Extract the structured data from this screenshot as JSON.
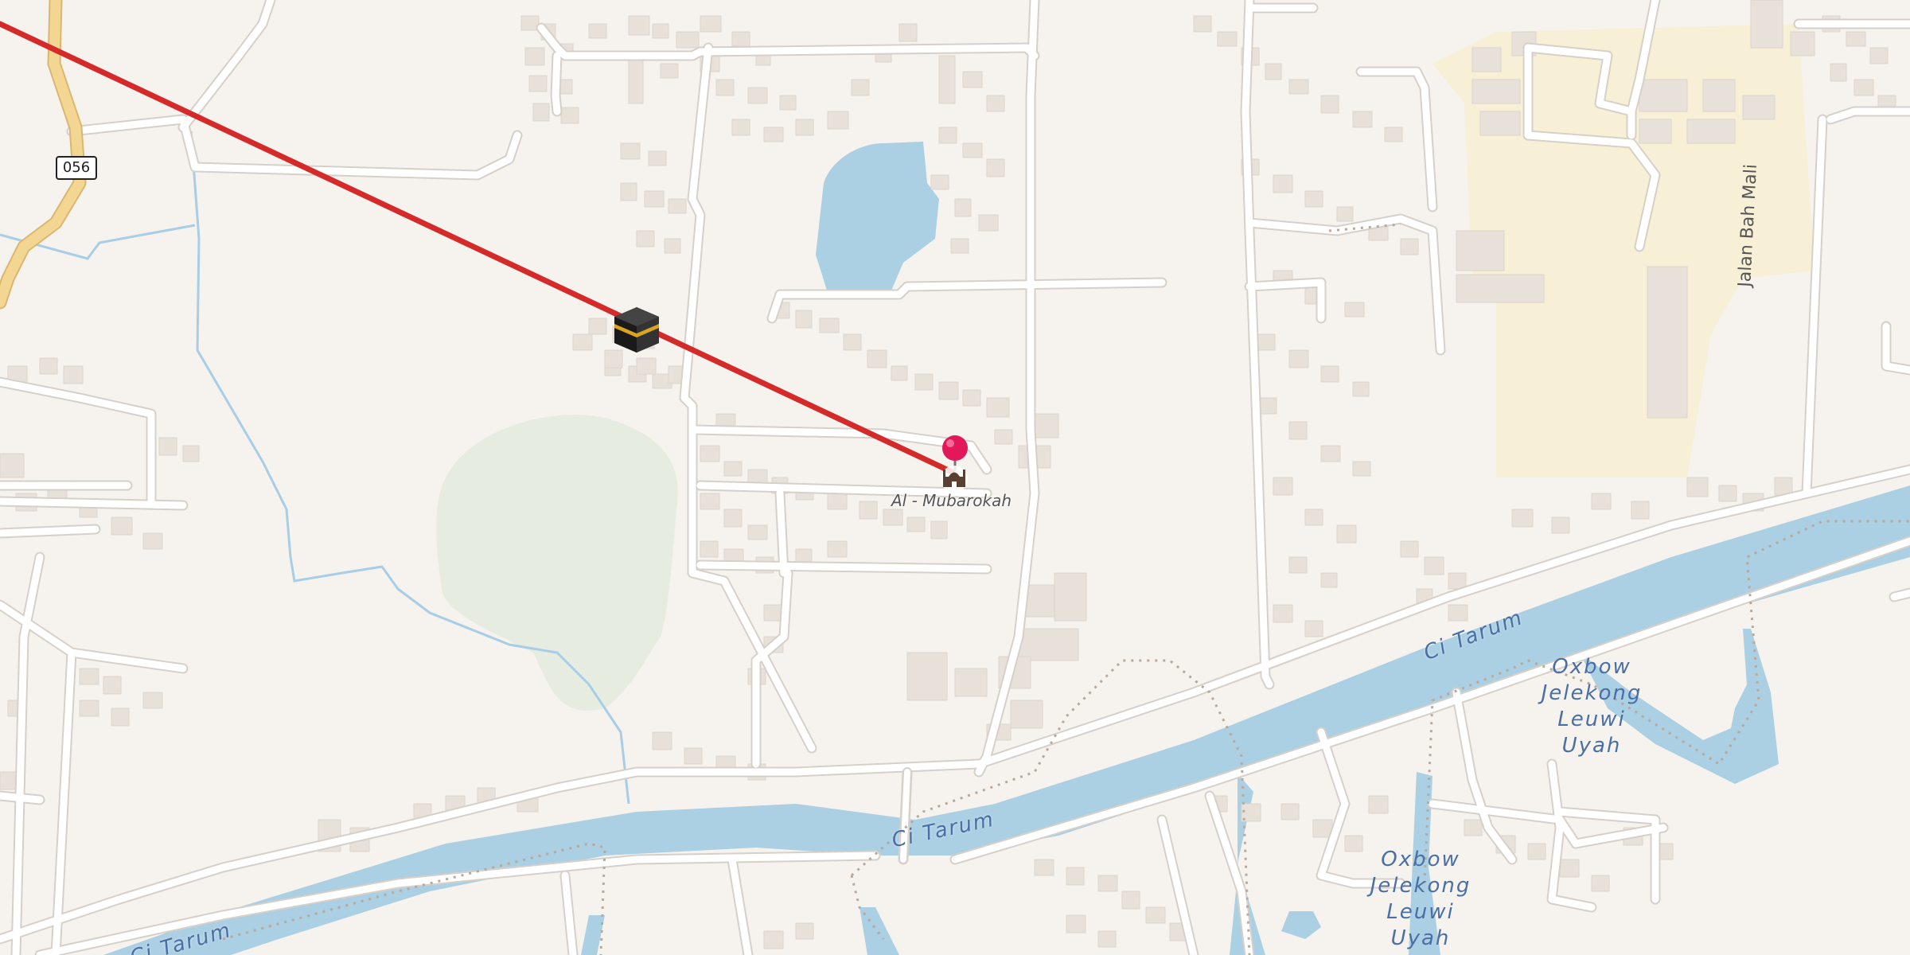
{
  "map": {
    "road_shield": "056",
    "street_label": "Jalan Bah Mali",
    "river_labels": [
      "Ci Tarum",
      "Ci Tarum",
      "Ci Tarum"
    ],
    "oxbow_labels": [
      {
        "lines": [
          "Oxbow",
          "Jelekong",
          "Leuwi",
          "Uyah"
        ]
      },
      {
        "lines": [
          "Oxbow",
          "Jelekong",
          "Leuwi",
          "Uyah"
        ]
      }
    ],
    "poi": {
      "label": "Al - Mubarokah",
      "icon": "mosque-icon",
      "marker": "map-pin-icon"
    },
    "destination_icon": "kaaba-icon",
    "colors": {
      "background": "#f6f3ef",
      "water": "#abcfe3",
      "qibla_line": "#d42a2a",
      "marker": "#e2185b",
      "industrial": "#f7efd6",
      "park": "#e6ede0",
      "road_casing": "#d6d0c8",
      "road_fill": "#ffffff",
      "primary_road": "#f3d692",
      "building": "#e8e1da"
    }
  }
}
